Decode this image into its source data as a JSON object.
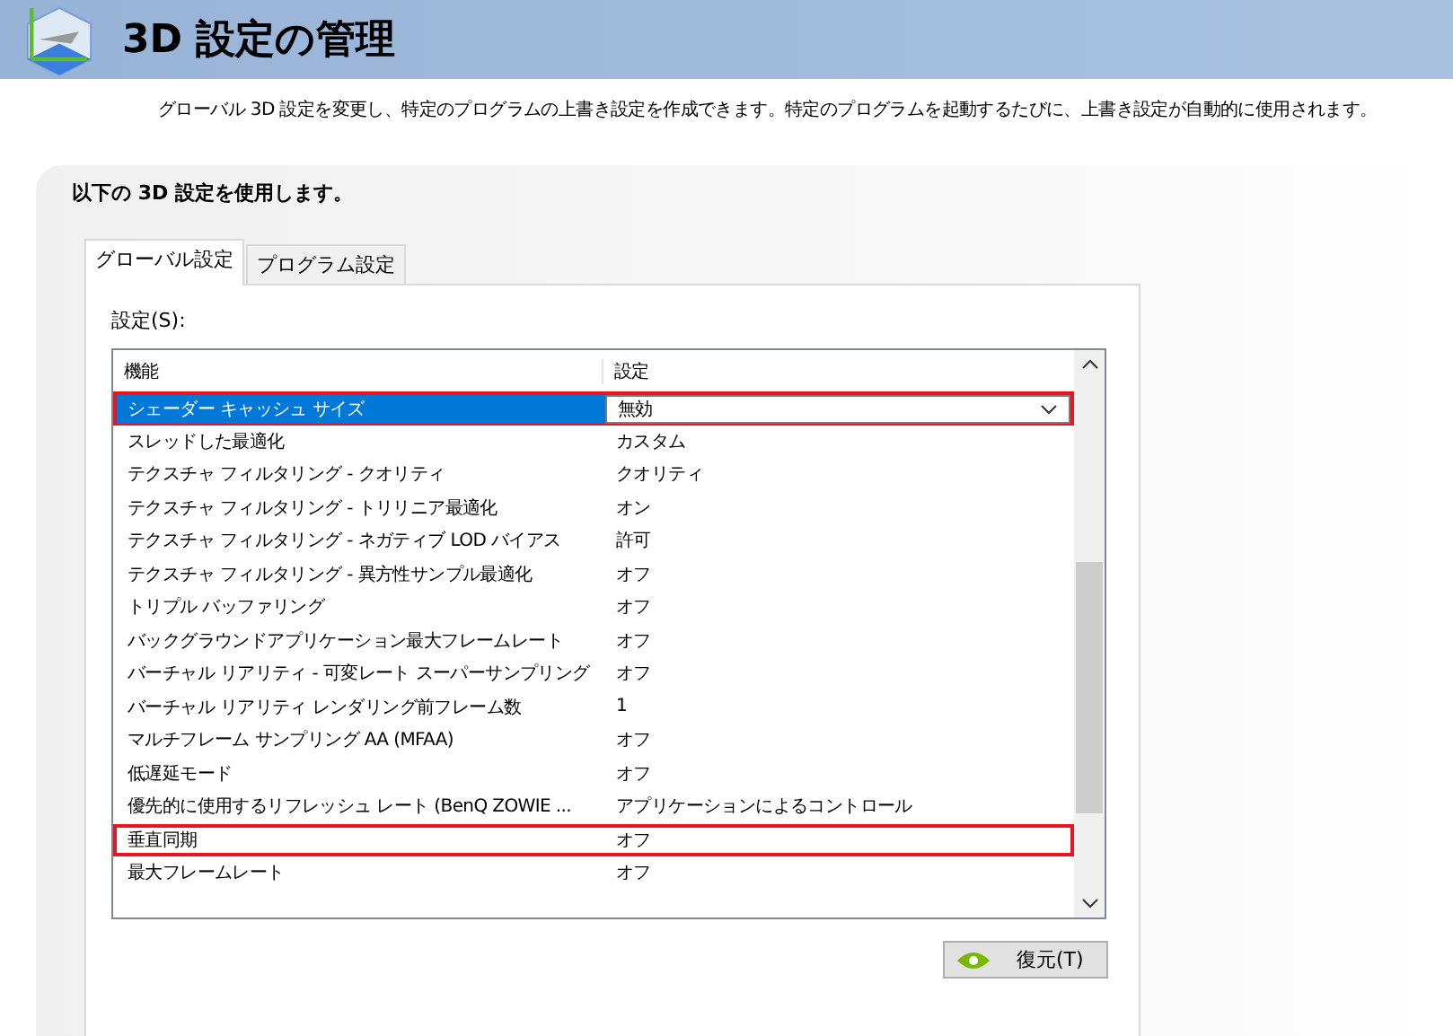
{
  "header": {
    "title": "3D 設定の管理"
  },
  "description": "グローバル 3D 設定を変更し、特定のプログラムの上書き設定を作成できます。特定のプログラムを起動するたびに、上書き設定が自動的に使用されます。",
  "panel": {
    "heading": "以下の 3D 設定を使用します。",
    "tabs": [
      {
        "label": "グローバル設定",
        "selected": true
      },
      {
        "label": "プログラム設定",
        "selected": false
      }
    ],
    "list_label": "設定(S):",
    "table": {
      "columns": [
        "機能",
        "設定"
      ],
      "rows": [
        {
          "feature": "シェーダー キャッシュ サイズ",
          "value": "無効",
          "selected": true,
          "highlighted": true
        },
        {
          "feature": "スレッドした最適化",
          "value": "カスタム",
          "selected": false,
          "highlighted": false
        },
        {
          "feature": "テクスチャ フィルタリング - クオリティ",
          "value": "クオリティ",
          "selected": false,
          "highlighted": false
        },
        {
          "feature": "テクスチャ フィルタリング - トリリニア最適化",
          "value": "オン",
          "selected": false,
          "highlighted": false
        },
        {
          "feature": "テクスチャ フィルタリング - ネガティブ LOD バイアス",
          "value": "許可",
          "selected": false,
          "highlighted": false
        },
        {
          "feature": "テクスチャ フィルタリング - 異方性サンプル最適化",
          "value": "オフ",
          "selected": false,
          "highlighted": false
        },
        {
          "feature": "トリプル バッファリング",
          "value": "オフ",
          "selected": false,
          "highlighted": false
        },
        {
          "feature": "バックグラウンドアプリケーション最大フレームレート",
          "value": "オフ",
          "selected": false,
          "highlighted": false
        },
        {
          "feature": "バーチャル リアリティ - 可変レート スーパーサンプリング",
          "value": "オフ",
          "selected": false,
          "highlighted": false
        },
        {
          "feature": "バーチャル リアリティ レンダリング前フレーム数",
          "value": "1",
          "selected": false,
          "highlighted": false
        },
        {
          "feature": "マルチフレーム サンプリング AA (MFAA)",
          "value": "オフ",
          "selected": false,
          "highlighted": false
        },
        {
          "feature": "低遅延モード",
          "value": "オフ",
          "selected": false,
          "highlighted": false
        },
        {
          "feature": "優先的に使用するリフレッシュ レート (BenQ ZOWIE ...",
          "value": "アプリケーションによるコントロール",
          "selected": false,
          "highlighted": false
        },
        {
          "feature": "垂直同期",
          "value": "オフ",
          "selected": false,
          "highlighted": true
        },
        {
          "feature": "最大フレームレート",
          "value": "オフ",
          "selected": false,
          "highlighted": false
        }
      ]
    },
    "restore_button": "復元(T)"
  }
}
